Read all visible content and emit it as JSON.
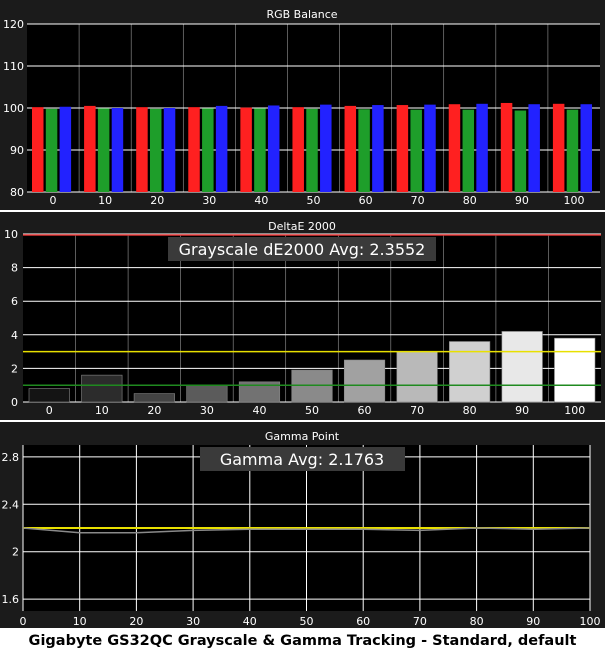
{
  "caption": "Gigabyte GS32QC Grayscale & Gamma Tracking - Standard, default",
  "colors": {
    "panel_bg": "#1b1b1b",
    "plot_bg": "#000000",
    "grid": "#ffffff",
    "text": "#ffffff",
    "red": "#ff2020",
    "green": "#1e9e2a",
    "blue": "#2222ff",
    "yellow": "#e8e000",
    "delta_green": "#1f8a1f",
    "delta_red": "#e03030",
    "avg_label_bg": "#3a3a3a"
  },
  "chart_data": [
    {
      "type": "bar",
      "title": "RGB Balance",
      "categories": [
        "0",
        "10",
        "20",
        "30",
        "40",
        "50",
        "60",
        "70",
        "80",
        "90",
        "100"
      ],
      "series": [
        {
          "color": "red",
          "values": [
            100.2,
            100.5,
            100.2,
            100.2,
            100.1,
            100.2,
            100.5,
            100.7,
            100.9,
            101.2,
            101.0
          ]
        },
        {
          "color": "green",
          "values": [
            99.8,
            99.9,
            99.8,
            99.9,
            99.9,
            99.8,
            99.7,
            99.6,
            99.6,
            99.4,
            99.6
          ]
        },
        {
          "color": "blue",
          "values": [
            100.3,
            100.0,
            100.0,
            100.5,
            100.6,
            100.8,
            100.7,
            100.8,
            101.0,
            100.9,
            100.9
          ]
        }
      ],
      "ylim": [
        80,
        120
      ],
      "yticks": [
        80,
        90,
        100,
        110,
        120
      ],
      "grid": true
    },
    {
      "type": "bar",
      "title": "DeltaE 2000",
      "annotation": "Grayscale dE2000 Avg: 2.3552",
      "categories": [
        "0",
        "10",
        "20",
        "30",
        "40",
        "50",
        "60",
        "70",
        "80",
        "90",
        "100"
      ],
      "values": [
        0.8,
        1.6,
        0.5,
        1.0,
        1.2,
        1.9,
        2.5,
        3.0,
        3.6,
        4.2,
        3.8
      ],
      "reference_lines": [
        {
          "value": 1,
          "color": "green"
        },
        {
          "value": 3,
          "color": "yellow"
        },
        {
          "value": 10,
          "color": "red"
        }
      ],
      "ylim": [
        0,
        10
      ],
      "yticks": [
        0,
        2,
        4,
        6,
        8,
        10
      ],
      "grid": true
    },
    {
      "type": "line",
      "title": "Gamma Point",
      "annotation": "Gamma Avg: 2.1763",
      "x": [
        0,
        10,
        20,
        30,
        40,
        50,
        60,
        70,
        80,
        90,
        100
      ],
      "series": [
        {
          "color": "yellow",
          "values": [
            2.2,
            2.2,
            2.2,
            2.2,
            2.2,
            2.2,
            2.2,
            2.2,
            2.2,
            2.2,
            2.2
          ]
        },
        {
          "color": "gray",
          "values": [
            2.2,
            2.16,
            2.16,
            2.18,
            2.19,
            2.19,
            2.19,
            2.18,
            2.2,
            2.19,
            2.2
          ]
        }
      ],
      "xlim": [
        0,
        100
      ],
      "xticks": [
        0,
        10,
        20,
        30,
        40,
        50,
        60,
        70,
        80,
        90,
        100
      ],
      "ylim": [
        1.5,
        2.9
      ],
      "yticks": [
        1.6,
        2,
        2.4,
        2.8
      ],
      "grid": true
    }
  ]
}
